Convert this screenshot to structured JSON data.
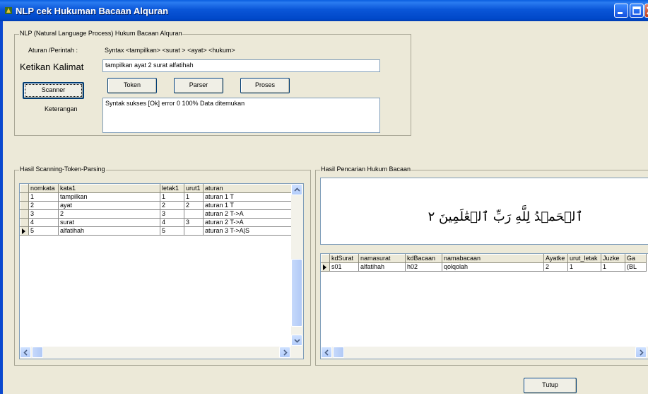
{
  "window": {
    "title": "NLP cek Hukuman Bacaan Alquran",
    "colors": {
      "titlebar": "#0a56d8",
      "face": "#ece9d8"
    }
  },
  "nlp_group": {
    "legend": "NLP (Natural Language Process) Hukum Bacaan Alquran",
    "rule_label": "Aturan /Perintah :",
    "rule_syntax": "Syntax <tampilkan> <surat > <ayat> <hukum>",
    "sentence_label": "Ketikan Kalimat",
    "sentence_value": "tampilkan ayat 2 surat alfatihah",
    "scanner_button": "Scanner",
    "token_button": "Token",
    "parser_button": "Parser",
    "proses_button": "Proses",
    "info_label": "Keterangan",
    "info_value": "Syntak sukses [Ok] error 0   100% Data ditemukan"
  },
  "scan_group": {
    "legend": "Hasil Scanning-Token-Parsing",
    "columns": [
      "nomkata",
      "kata1",
      "letak1",
      "urut1",
      "aturan"
    ],
    "rows": [
      [
        "1",
        "tampilkan",
        "1",
        "1",
        "aturan 1 T"
      ],
      [
        "2",
        "ayat",
        "2",
        "2",
        "aturan 1 T"
      ],
      [
        "3",
        "2",
        "3",
        "",
        "aturan 2 T->A"
      ],
      [
        "4",
        "surat",
        "4",
        "3",
        "aturan 2 T->A"
      ],
      [
        "5",
        "alfatihah",
        "5",
        "",
        "aturan 3 T->A|S"
      ]
    ],
    "current_row": 4
  },
  "result_group": {
    "legend": "Hasil  Pencarian Hukum Bacaan",
    "arabic_text": "ٱلۡحَمۡدُ لِلَّهِ رَبِّ ٱلۡعَٰلَمِينَ ٢",
    "columns": [
      "kdSurat",
      "namasurat",
      "kdBacaan",
      "namabacaan",
      "Ayatke",
      "urut_letak",
      "Juzke",
      "Ga"
    ],
    "rows": [
      [
        "s01",
        "alfatihah",
        "h02",
        "qolqolah",
        "2",
        "1",
        "1",
        "(BL"
      ]
    ]
  },
  "footer": {
    "close_button": "Tutup"
  },
  "icons": [
    "app-icon",
    "minimize-icon",
    "maximize-icon",
    "close-icon",
    "row-pointer-icon",
    "scroll-up-icon",
    "scroll-down-icon",
    "scroll-left-icon",
    "scroll-right-icon"
  ]
}
